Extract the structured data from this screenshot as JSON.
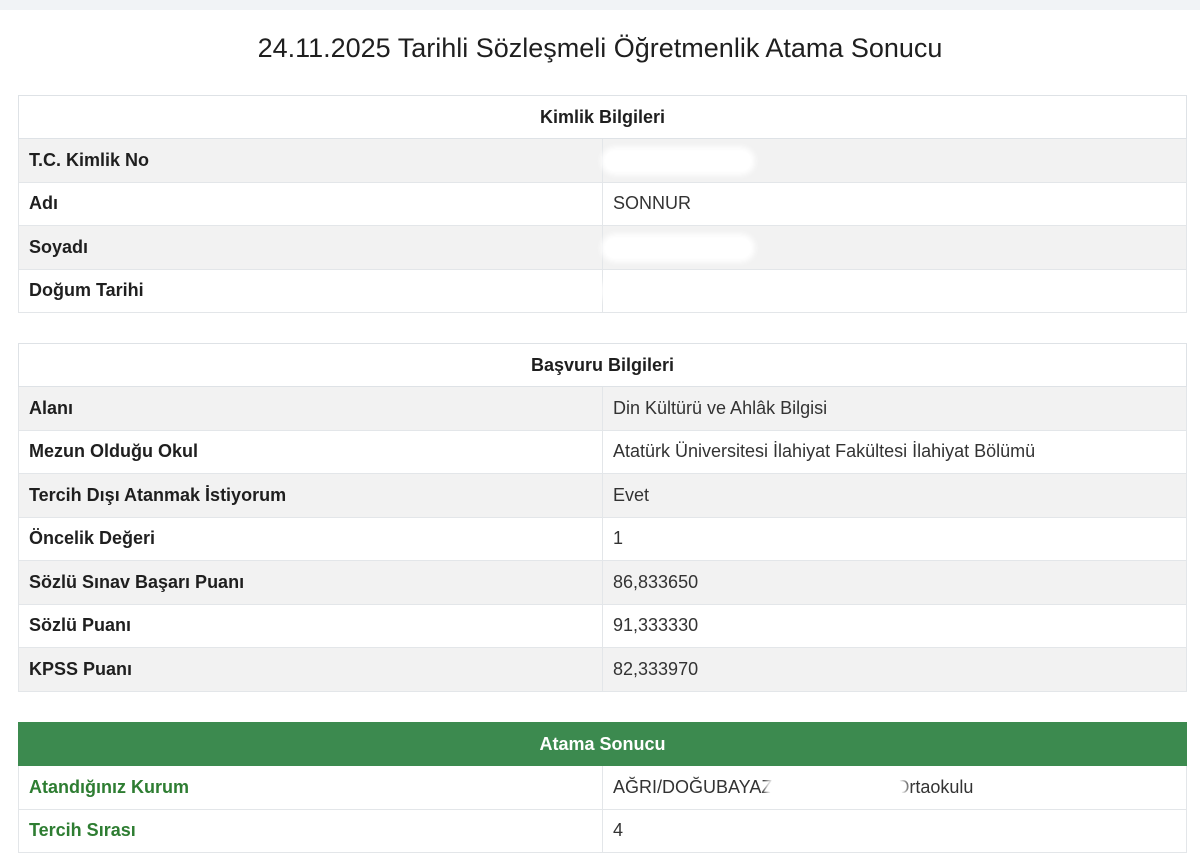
{
  "title": "24.11.2025 Tarihli Sözleşmeli Öğretmenlik Atama Sonucu",
  "kimlik": {
    "heading": "Kimlik Bilgileri",
    "rows": [
      {
        "label": "T.C. Kimlik No",
        "value": ""
      },
      {
        "label": "Adı",
        "value": "SONNUR"
      },
      {
        "label": "Soyadı",
        "value": ""
      },
      {
        "label": "Doğum Tarihi",
        "value": ""
      }
    ]
  },
  "basvuru": {
    "heading": "Başvuru Bilgileri",
    "rows": [
      {
        "label": "Alanı",
        "value": "Din Kültürü ve Ahlâk Bilgisi"
      },
      {
        "label": "Mezun Olduğu Okul",
        "value": "Atatürk Üniversitesi İlahiyat Fakültesi İlahiyat Bölümü"
      },
      {
        "label": "Tercih Dışı Atanmak İstiyorum",
        "value": "Evet"
      },
      {
        "label": "Öncelik Değeri",
        "value": "1"
      },
      {
        "label": "Sözlü Sınav Başarı Puanı",
        "value": "86,833650"
      },
      {
        "label": "Sözlü Puanı",
        "value": "91,333330"
      },
      {
        "label": "KPSS Puanı",
        "value": "82,333970"
      }
    ]
  },
  "atama": {
    "heading": "Atama Sonucu",
    "kurum_label": "Atandığınız Kurum",
    "kurum_value_prefix": "AĞRI/DOĞUBAYAZI",
    "kurum_value_suffix": "Ortaokulu",
    "tercih_label": "Tercih Sırası",
    "tercih_value": "4"
  },
  "colors": {
    "result_header": "#3c8a4f",
    "result_label": "#2e7d32",
    "striped_row": "#f2f2f2"
  }
}
